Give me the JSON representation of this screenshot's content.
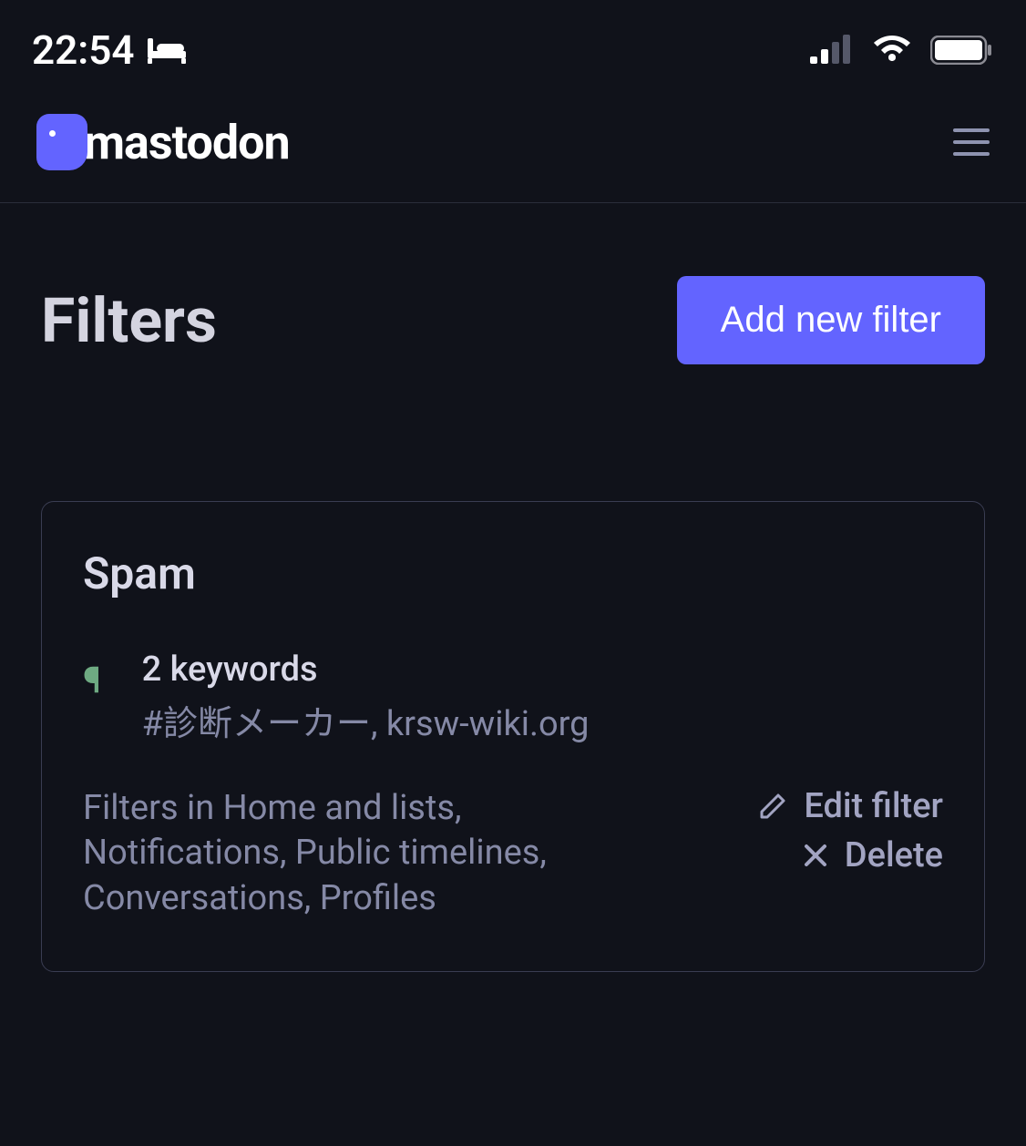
{
  "status_bar": {
    "time": "22:54"
  },
  "header": {
    "app_name": "mastodon"
  },
  "page": {
    "title": "Filters",
    "add_button_label": "Add new filter"
  },
  "filters": [
    {
      "name": "Spam",
      "keywords_count_label": "2 keywords",
      "keywords_list": "#診断メーカー, krsw-wiki.org",
      "contexts": "Filters in Home and lists, Notifications, Public timelines, Conversations, Profiles",
      "edit_label": "Edit filter",
      "delete_label": "Delete"
    }
  ]
}
